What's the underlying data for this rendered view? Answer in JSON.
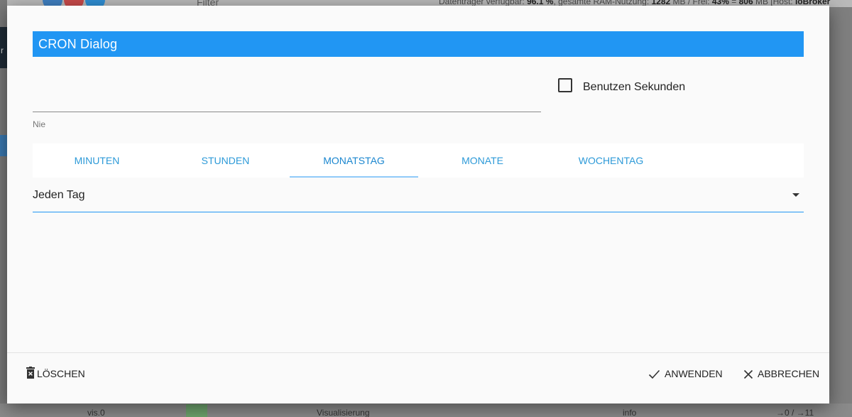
{
  "background": {
    "filter_label": "Filter",
    "status_text_prefix": "Datenträger verfügbar: ",
    "disk_value": "96.1 %",
    "ram_prefix": ", gesamte RAM-Nutzung: ",
    "ram_value": "1282",
    "ram_unit": " MB / Frei: ",
    "free_percent": "43%",
    "free_eq": " = ",
    "free_mb": "806",
    "host_prefix": " MB [Host: ",
    "host_name": "ioBroker",
    "left_mark": "r",
    "bottom_row": {
      "instance": "vis.0",
      "title": "Visualisierung",
      "log_level": "info",
      "counts": "→0 / →11"
    }
  },
  "dialog": {
    "title": "CRON Dialog",
    "cron_value": "",
    "description": "Nie",
    "use_seconds_label": "Benutzen Sekunden",
    "use_seconds_checked": false,
    "tabs": [
      {
        "label": "MINUTEN",
        "active": false
      },
      {
        "label": "STUNDEN",
        "active": false
      },
      {
        "label": "MONATSTAG",
        "active": true
      },
      {
        "label": "MONATE",
        "active": false
      },
      {
        "label": "WOCHENTAG",
        "active": false
      }
    ],
    "day_select_value": "Jeden Tag",
    "buttons": {
      "delete": "LÖSCHEN",
      "apply": "ANWENDEN",
      "cancel": "ABBRECHEN"
    },
    "accent_color": "#2196f3"
  }
}
